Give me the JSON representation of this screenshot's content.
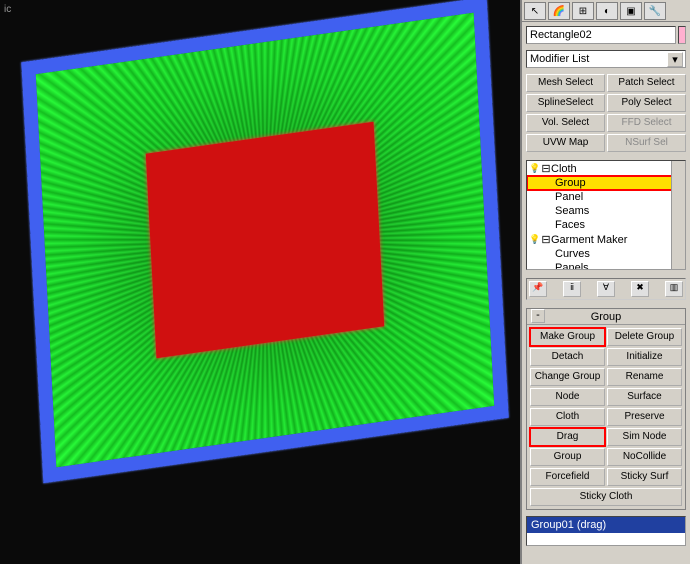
{
  "viewport": {
    "label": "ic"
  },
  "object_name": "Rectangle02",
  "modifier_dropdown": "Modifier List",
  "quick_buttons": {
    "mesh_select": "Mesh Select",
    "patch_select": "Patch Select",
    "spline_select": "SplineSelect",
    "poly_select": "Poly Select",
    "vol_select": "Vol. Select",
    "ffd_select": "FFD Select",
    "uvw_map": "UVW Map",
    "nsurf_sel": "NSurf Sel"
  },
  "stack": {
    "cloth": "Cloth",
    "group": "Group",
    "panel": "Panel",
    "seams": "Seams",
    "faces": "Faces",
    "garment": "Garment Maker",
    "curves": "Curves",
    "panels": "Panels"
  },
  "rollout_title": "Group",
  "group_buttons": {
    "make_group": "Make Group",
    "delete_group": "Delete Group",
    "detach": "Detach",
    "initialize": "Initialize",
    "change_group": "Change Group",
    "rename": "Rename",
    "node": "Node",
    "surface": "Surface",
    "cloth": "Cloth",
    "preserve": "Preserve",
    "drag": "Drag",
    "sim_node": "Sim Node",
    "group": "Group",
    "nocollide": "NoCollide",
    "forcefield": "Forcefield",
    "sticky_surf": "Sticky Surf",
    "sticky_cloth": "Sticky Cloth"
  },
  "group_list_item": "Group01 (drag)"
}
